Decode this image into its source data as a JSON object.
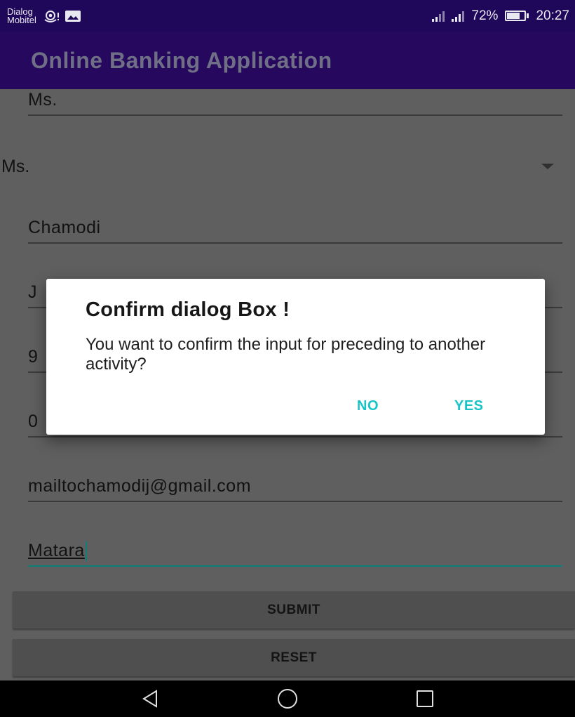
{
  "status_bar": {
    "carrier_line1": "Dialog",
    "carrier_line2": "Mobitel",
    "battery_percent_text": "72%",
    "battery_level": 0.72,
    "time": "20:27",
    "icons": [
      "hotspot-icon",
      "image-notification-icon",
      "signal-icon",
      "signal-icon",
      "battery-icon"
    ]
  },
  "app_bar": {
    "title": "Online Banking Application"
  },
  "form": {
    "title_field": "Ms.",
    "title_spinner": {
      "selected": "Ms."
    },
    "first_name": "Chamodi",
    "last_name_partial": "J",
    "nic_partial": "9",
    "phone_partial": "0",
    "email": "mailtochamodij@gmail.com",
    "city": "Matara",
    "submit_label": "SUBMIT",
    "reset_label": "RESET"
  },
  "dialog": {
    "title": "Confirm dialog Box !",
    "message": "You want to confirm the input for preceding to another activity?",
    "no_label": "NO",
    "yes_label": "YES"
  },
  "colors": {
    "primary_dark": "#1f0759",
    "primary": "#26095f",
    "accent": "#19c4c8",
    "field_active": "#0f7f7c"
  }
}
